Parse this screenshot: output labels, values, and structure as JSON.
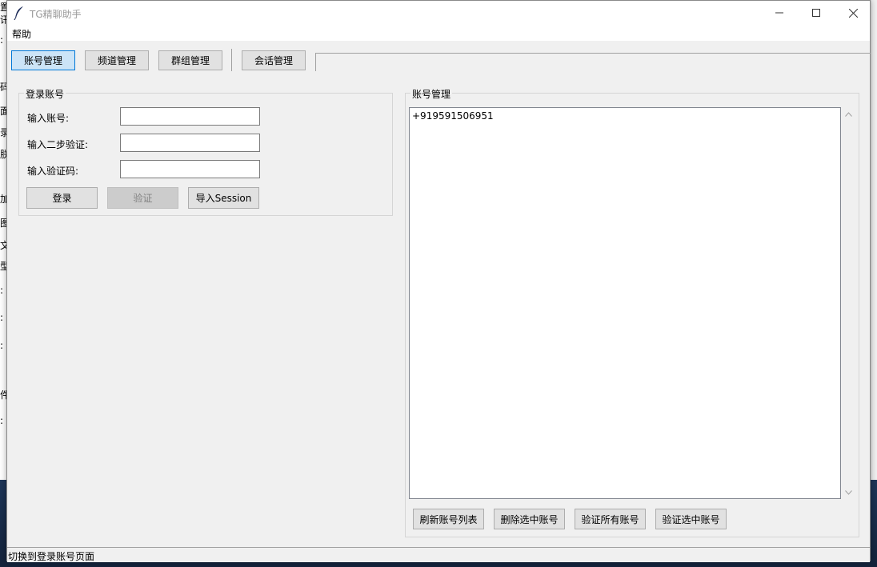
{
  "window": {
    "title": "TG精聊助手"
  },
  "menu": {
    "help": "帮助"
  },
  "tabs": [
    {
      "label": "账号管理",
      "active": true
    },
    {
      "label": "频道管理",
      "active": false
    },
    {
      "label": "群组管理",
      "active": false
    },
    {
      "label": "会话管理",
      "active": false
    }
  ],
  "login_group": {
    "title": "登录账号",
    "account_label": "输入账号:",
    "account_value": "",
    "twofa_label": "输入二步验证:",
    "twofa_value": "",
    "code_label": "输入验证码:",
    "code_value": "",
    "login_button": "登录",
    "verify_button": "验证",
    "import_button": "导入Session"
  },
  "account_group": {
    "title": "账号管理",
    "accounts": [
      "+919591506951"
    ],
    "refresh_button": "刷新账号列表",
    "delete_button": "删除选中账号",
    "verify_all_button": "验证所有账号",
    "verify_selected_button": "验证选中账号"
  },
  "status": {
    "text": "切换到登录账号页面"
  },
  "background_glyphs": [
    "置",
    "讯",
    ":",
    "码",
    "面",
    "录",
    "朕",
    "加",
    "图",
    "文",
    "型",
    ":",
    ":",
    ":",
    "件",
    ":"
  ],
  "colors": {
    "active_tab_bg": "#cce4f7",
    "active_tab_border": "#0078d7",
    "window_bg": "#f0f0f0"
  }
}
